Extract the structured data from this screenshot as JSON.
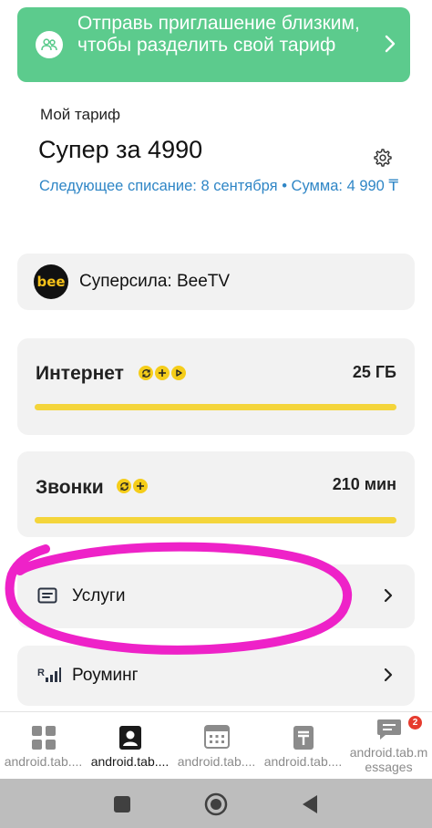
{
  "invite_banner": {
    "text": "Отправь приглашение близким, чтобы разделить свой тариф",
    "icon": "people-icon"
  },
  "tariff": {
    "label": "Мой тариф",
    "name": "Супер за 4990",
    "billing": "Следующее списание: 8 сентября  • Сумма: 4 990 ₸"
  },
  "beetv": {
    "logo_text": "bee",
    "title": "Суперсила: BeeTV"
  },
  "internet": {
    "title": "Интернет",
    "value": "25 ГБ",
    "remaining_fraction": 1.0,
    "badges": [
      "refresh-icon",
      "plus-icon",
      "play-icon"
    ]
  },
  "calls": {
    "title": "Звонки",
    "value": "210 мин",
    "remaining_fraction": 1.0,
    "badges": [
      "refresh-icon",
      "plus-icon"
    ]
  },
  "services": {
    "title": "Услуги"
  },
  "roaming": {
    "title": "Роуминг"
  },
  "tabbar": {
    "tabs": [
      {
        "label": "android.tab....",
        "icon": "grid-icon",
        "active": false
      },
      {
        "label": "android.tab....",
        "icon": "profile-icon",
        "active": true
      },
      {
        "label": "android.tab....",
        "icon": "calculator-icon",
        "active": false
      },
      {
        "label": "android.tab....",
        "icon": "tenge-icon",
        "active": false
      },
      {
        "label": "android.tab.m essages",
        "icon": "chat-icon",
        "active": false,
        "badge": "2"
      }
    ]
  },
  "colors": {
    "banner": "#5ccb8d",
    "accent_yellow": "#f5cd1a",
    "link_blue": "#2f86c6",
    "annotation_magenta": "#ee22c8"
  }
}
